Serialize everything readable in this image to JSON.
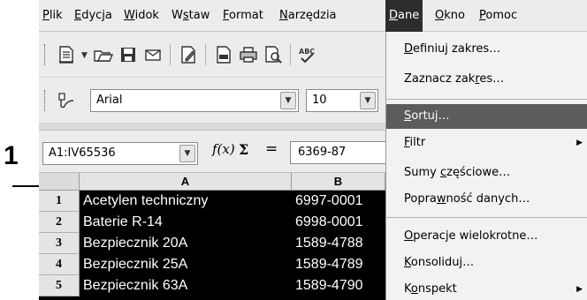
{
  "callout": {
    "number": "1"
  },
  "menubar": {
    "items": [
      {
        "pre": "",
        "key": "P",
        "post": "lik"
      },
      {
        "pre": "",
        "key": "E",
        "post": "dycja"
      },
      {
        "pre": "",
        "key": "W",
        "post": "idok"
      },
      {
        "pre": "W",
        "key": "s",
        "post": "taw"
      },
      {
        "pre": "",
        "key": "F",
        "post": "ormat"
      },
      {
        "pre": "",
        "key": "N",
        "post": "arzędzia"
      },
      {
        "pre": "",
        "key": "D",
        "post": "ane"
      },
      {
        "pre": "",
        "key": "O",
        "post": "kno"
      },
      {
        "pre": "",
        "key": "P",
        "post": "omoc"
      }
    ],
    "active_index": 6
  },
  "toolbar": {
    "font_name": "Arial",
    "font_size": "10"
  },
  "formula_bar": {
    "name_box": "A1:IV65536",
    "fx_label": "f(x)",
    "sigma_label": "Σ",
    "equals_label": "=",
    "input_value": "6369-87"
  },
  "sheet": {
    "columns": [
      "A",
      "B"
    ],
    "rows": [
      {
        "num": "1",
        "a": "Acetylen techniczny",
        "b": "6997-0001"
      },
      {
        "num": "2",
        "a": "Baterie R-14",
        "b": "6998-0001"
      },
      {
        "num": "3",
        "a": "Bezpiecznik  20A",
        "b": "1589-4788"
      },
      {
        "num": "4",
        "a": "Bezpiecznik  25A",
        "b": "1589-4789"
      },
      {
        "num": "5",
        "a": "Bezpiecznik  63A",
        "b": "1589-4790"
      }
    ]
  },
  "dropdown": {
    "items": [
      {
        "pre": "",
        "key": "D",
        "post": "efiniuj zakres…",
        "submenu": false
      },
      {
        "pre": "Zaznacz zak",
        "key": "r",
        "post": "es…",
        "submenu": false
      },
      {
        "pre": "",
        "key": "S",
        "post": "ortuj…",
        "submenu": false
      },
      {
        "pre": "",
        "key": "F",
        "post": "iltr",
        "submenu": true
      },
      {
        "pre": "Sumy ",
        "key": "c",
        "post": "zęściowe…",
        "submenu": false
      },
      {
        "pre": "Popra",
        "key": "w",
        "post": "ność danych…",
        "submenu": false
      },
      {
        "pre": "",
        "key": "O",
        "post": "peracje wielokrotne…",
        "submenu": false
      },
      {
        "pre": "",
        "key": "K",
        "post": "onsoliduj…",
        "submenu": false
      },
      {
        "pre": "K",
        "key": "o",
        "post": "nspekt",
        "submenu": true
      }
    ],
    "highlighted_index": 2
  }
}
